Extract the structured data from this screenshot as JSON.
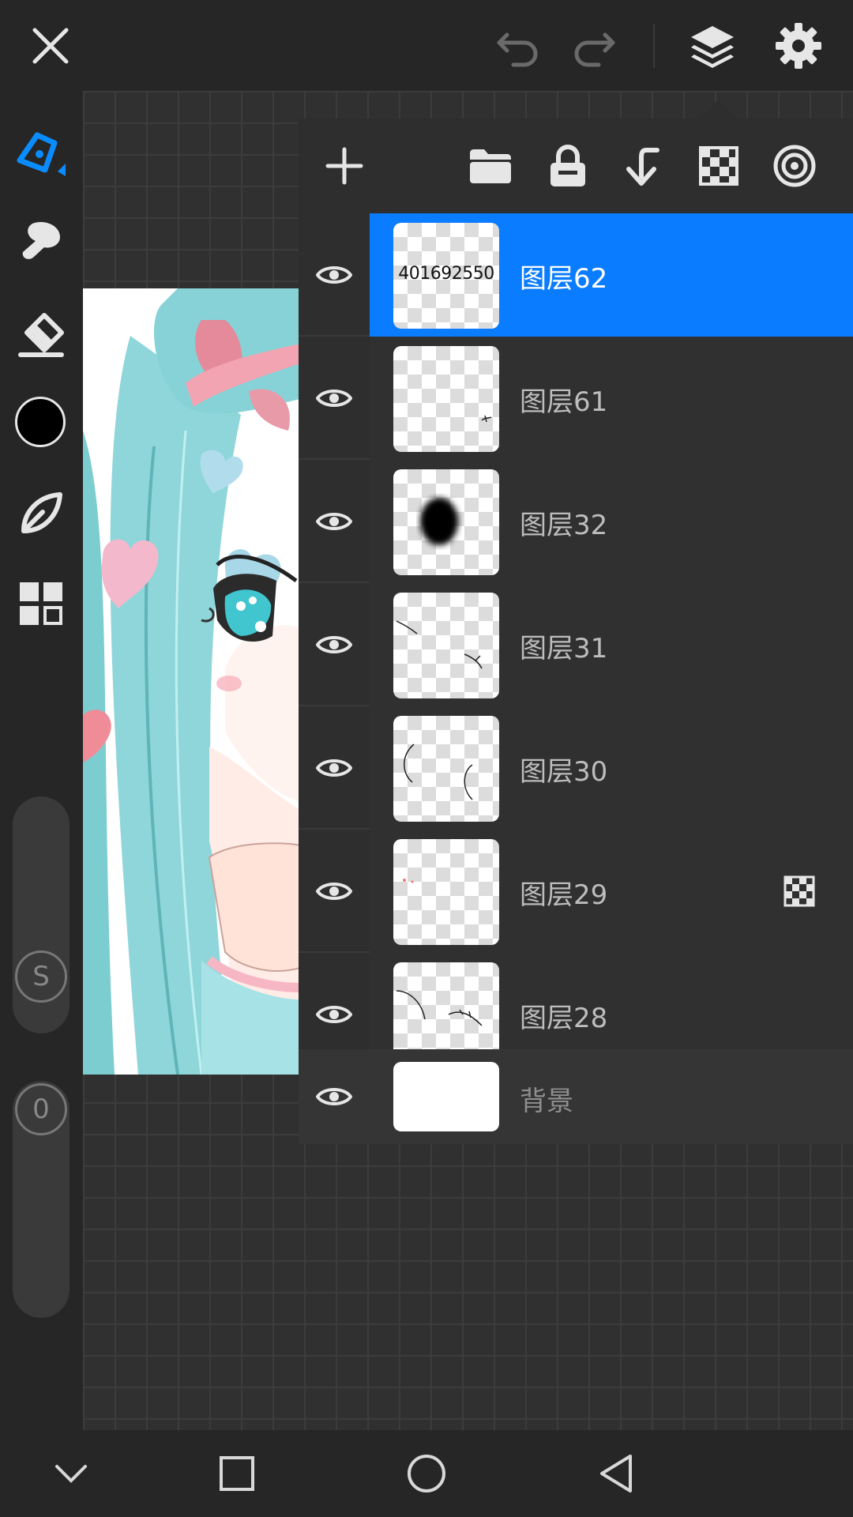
{
  "topbar": {
    "icons": [
      "close-icon",
      "undo-icon",
      "redo-icon",
      "layers-icon",
      "settings-icon"
    ]
  },
  "sidebar": {
    "tools": [
      "pen-icon",
      "smudge-icon",
      "eraser-icon",
      "color-swatch",
      "brush-icon",
      "grid-icon"
    ],
    "current_color": "#000000",
    "size_slider_label": "S",
    "opacity_slider_label": "0"
  },
  "layer_panel": {
    "toolbar_icons": [
      "add-layer-icon",
      "folder-icon",
      "lock-icon",
      "merge-down-icon",
      "alpha-lock-icon",
      "blend-icon"
    ],
    "selected_color": "#0a7cff",
    "layers": [
      {
        "name": "图层62",
        "thumb_text": "401692550",
        "selected": true
      },
      {
        "name": "图层61",
        "thumb_text": "",
        "selected": false
      },
      {
        "name": "图层32",
        "thumb_text": "",
        "selected": false
      },
      {
        "name": "图层31",
        "thumb_text": "",
        "selected": false
      },
      {
        "name": "图层30",
        "thumb_text": "",
        "selected": false
      },
      {
        "name": "图层29",
        "thumb_text": "",
        "selected": false,
        "alpha_locked": true
      },
      {
        "name": "图层28",
        "thumb_text": "",
        "selected": false
      }
    ],
    "background_layer": {
      "name": "背景"
    }
  },
  "navbar": {
    "icons": [
      "nav-down-icon",
      "recents-icon",
      "home-icon",
      "back-icon"
    ]
  }
}
